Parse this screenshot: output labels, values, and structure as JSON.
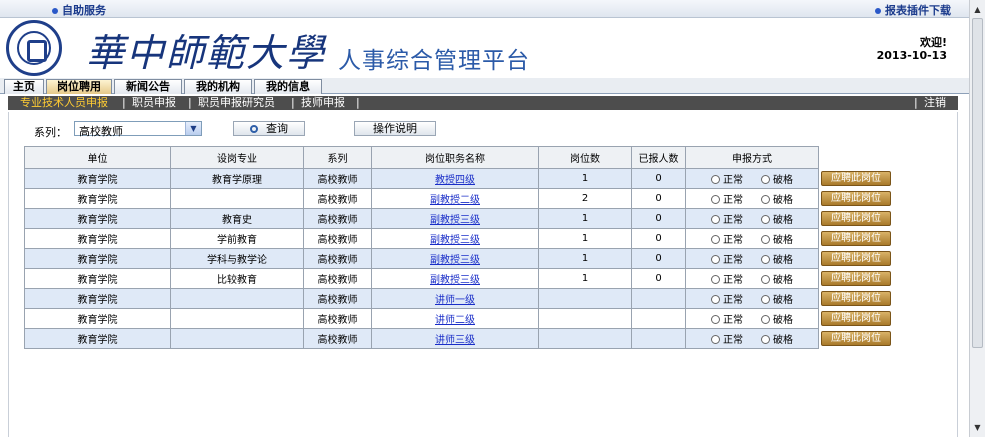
{
  "topbar": {
    "self_service": "自助服务",
    "report_plugin": "报表插件下载"
  },
  "header": {
    "university_name": "華中師範大學",
    "platform_name": "人事综合管理平台",
    "welcome": "欢迎!",
    "date": "2013-10-13"
  },
  "tabs": [
    "主页",
    "岗位聘用",
    "新闻公告",
    "我的机构",
    "我的信息"
  ],
  "subnav": {
    "items": [
      "专业技术人员申报",
      "职员申报",
      "职员申报研究员",
      "技师申报"
    ],
    "logout": "注销"
  },
  "filters": {
    "series_label": "系列：",
    "series_value": "高校教师",
    "query_label": "查询",
    "help_label": "操作说明"
  },
  "table": {
    "headers": [
      "单位",
      "设岗专业",
      "系列",
      "岗位职务名称",
      "岗位数",
      "已报人数",
      "申报方式"
    ],
    "radio_normal": "正常",
    "radio_exception": "破格",
    "apply_label": "应聘此岗位",
    "rows": [
      {
        "unit": "教育学院",
        "major": "教育学原理",
        "series": "高校教师",
        "post": "教授四级",
        "count": "1",
        "applied": "0"
      },
      {
        "unit": "教育学院",
        "major": "",
        "series": "高校教师",
        "post": "副教授二级",
        "count": "2",
        "applied": "0"
      },
      {
        "unit": "教育学院",
        "major": "教育史",
        "series": "高校教师",
        "post": "副教授三级",
        "count": "1",
        "applied": "0"
      },
      {
        "unit": "教育学院",
        "major": "学前教育",
        "series": "高校教师",
        "post": "副教授三级",
        "count": "1",
        "applied": "0"
      },
      {
        "unit": "教育学院",
        "major": "学科与教学论",
        "series": "高校教师",
        "post": "副教授三级",
        "count": "1",
        "applied": "0"
      },
      {
        "unit": "教育学院",
        "major": "比较教育",
        "series": "高校教师",
        "post": "副教授三级",
        "count": "1",
        "applied": "0"
      },
      {
        "unit": "教育学院",
        "major": "",
        "series": "高校教师",
        "post": "讲师一级",
        "count": "",
        "applied": ""
      },
      {
        "unit": "教育学院",
        "major": "",
        "series": "高校教师",
        "post": "讲师二级",
        "count": "",
        "applied": ""
      },
      {
        "unit": "教育学院",
        "major": "",
        "series": "高校教师",
        "post": "讲师三级",
        "count": "",
        "applied": ""
      }
    ]
  },
  "colors": {
    "link": "#1a2ec8",
    "row_alt": "#dfe9f7",
    "subnav_bg": "#4d4d4d",
    "subnav_active": "#ffcc33",
    "apply_button": "#c0954a"
  }
}
